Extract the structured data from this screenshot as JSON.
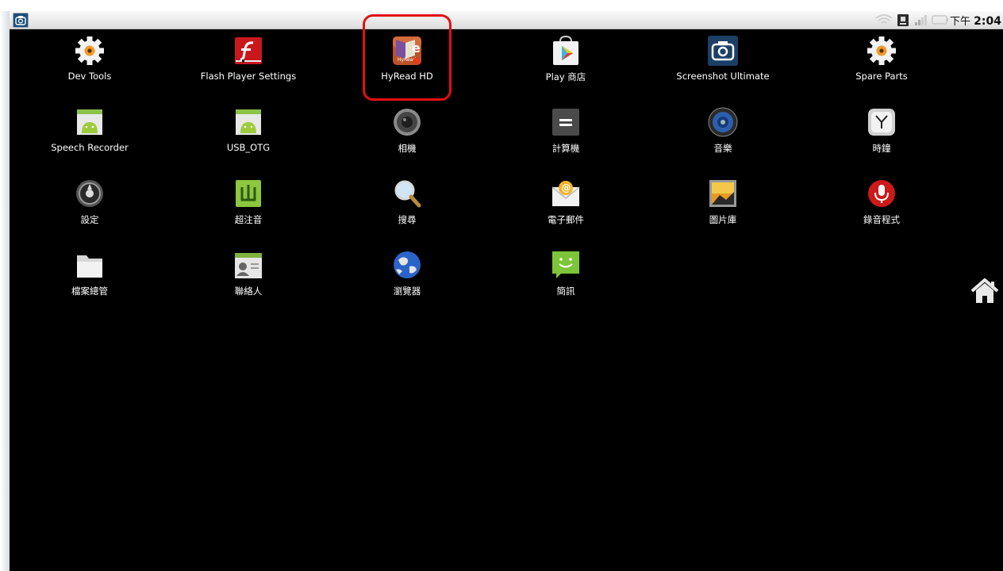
{
  "status_bar": {
    "clock_period": "下午",
    "clock_time": "2:04",
    "icons": [
      "screenshot-icon",
      "wifi-icon",
      "sim-icon",
      "signal-icon",
      "battery-icon"
    ]
  },
  "apps": [
    {
      "label": "Dev Tools",
      "icon": "gear-icon"
    },
    {
      "label": "Flash Player Settings",
      "icon": "flash-icon"
    },
    {
      "label": "HyRead HD",
      "icon": "hyread-icon"
    },
    {
      "label": "Play 商店",
      "icon": "play-store-icon"
    },
    {
      "label": "Screenshot Ultimate",
      "icon": "camera-icon"
    },
    {
      "label": "Spare Parts",
      "icon": "gear-icon"
    },
    {
      "label": "Speech Recorder",
      "icon": "android-icon"
    },
    {
      "label": "USB_OTG",
      "icon": "android-icon"
    },
    {
      "label": "相機",
      "icon": "camera-lens-icon"
    },
    {
      "label": "計算機",
      "icon": "calculator-icon"
    },
    {
      "label": "音樂",
      "icon": "speaker-icon"
    },
    {
      "label": "時鐘",
      "icon": "clock-icon"
    },
    {
      "label": "設定",
      "icon": "settings-icon"
    },
    {
      "label": "超注音",
      "icon": "zhuyin-icon"
    },
    {
      "label": "搜尋",
      "icon": "search-icon"
    },
    {
      "label": "電子郵件",
      "icon": "email-icon"
    },
    {
      "label": "圖片庫",
      "icon": "gallery-icon"
    },
    {
      "label": "錄音程式",
      "icon": "microphone-icon"
    },
    {
      "label": "檔案總管",
      "icon": "folder-icon"
    },
    {
      "label": "聯絡人",
      "icon": "contacts-icon"
    },
    {
      "label": "瀏覽器",
      "icon": "globe-icon"
    },
    {
      "label": "簡訊",
      "icon": "messaging-icon"
    }
  ],
  "highlight_color": "#e21010",
  "home_button": {
    "icon": "home-icon"
  }
}
